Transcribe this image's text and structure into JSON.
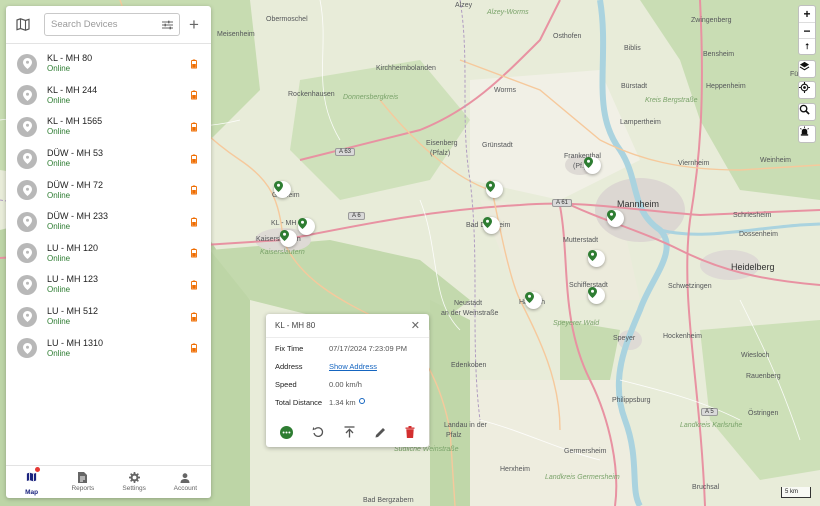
{
  "search": {
    "placeholder": "Search Devices"
  },
  "devices": [
    {
      "name": "KL - MH 80",
      "status": "Online"
    },
    {
      "name": "KL - MH 244",
      "status": "Online"
    },
    {
      "name": "KL - MH 1565",
      "status": "Online"
    },
    {
      "name": "DÜW - MH 53",
      "status": "Online"
    },
    {
      "name": "DÜW - MH 72",
      "status": "Online"
    },
    {
      "name": "DÜW - MH 233",
      "status": "Online"
    },
    {
      "name": "LU - MH 120",
      "status": "Online"
    },
    {
      "name": "LU - MH 123",
      "status": "Online"
    },
    {
      "name": "LU - MH 512",
      "status": "Online"
    },
    {
      "name": "LU - MH 1310",
      "status": "Online"
    }
  ],
  "nav": {
    "map": "Map",
    "reports": "Reports",
    "settings": "Settings",
    "account": "Account"
  },
  "popup": {
    "title": "KL - MH 80",
    "fix_time_label": "Fix Time",
    "fix_time": "07/17/2024 7:23:09 PM",
    "address_label": "Address",
    "address_link": "Show Address",
    "speed_label": "Speed",
    "speed": "0.00 km/h",
    "distance_label": "Total Distance",
    "distance": "1.34 km"
  },
  "map": {
    "places": {
      "obermoschel": "Obermoschel",
      "meisenheim": "Meisenheim",
      "alzey": "Alzey",
      "alzey_worms": "Alzey-Worms",
      "osthofen": "Osthofen",
      "zwingenberg": "Zwingenberg",
      "bensheim": "Bensheim",
      "biblis": "Biblis",
      "kirchheimbolanden": "Kirchheimbolanden",
      "donnersberg": "Donnersbergkreis",
      "rockenhausen": "Rockenhausen",
      "worms": "Worms",
      "buerstadt": "Bürstadt",
      "heppenheim": "Heppenheim",
      "kreis_bergstrasse": "Kreis Bergstraße",
      "lampertheim": "Lampertheim",
      "fuerth": "Fürth",
      "eisenberg": "Eisenberg",
      "pfalz": "(Pfalz)",
      "gruenstadt": "Grünstadt",
      "frankenthal": "Frankenthal",
      "frankenthal_pf": "(Pf.)",
      "viernheim": "Viernheim",
      "weinheim": "Weinheim",
      "mannheim": "Mannheim",
      "schriesheim": "Schriesheim",
      "dossenheim": "Dossenheim",
      "heidelberg": "Heidelberg",
      "goellheim": "Göllheim",
      "kaiserslautern": "Kaiserslautern",
      "kaiserslautern_lk": "Kaiserslautern",
      "kl_mh": "KL - MH",
      "bad_duerkheim": "Bad Dürkheim",
      "mutterstadt": "Mutterstadt",
      "schifferstadt": "Schifferstadt",
      "schwetzingen": "Schwetzingen",
      "neustadt": "Neustadt",
      "an_der_weinstr": "an der Weinstraße",
      "hassloch": "Haßloch",
      "speyerer_wald": "Speyerer Wald",
      "speyer": "Speyer",
      "hockenheim": "Hockenheim",
      "wiesloch": "Wiesloch",
      "edenkoben": "Edenkoben",
      "rauenberg": "Rauenberg",
      "philippsburg": "Philippsburg",
      "oestringen": "Östringen",
      "landau": "Landau in der",
      "landau2": "Pfalz",
      "suedl_weinstr": "Südliche Weinstraße",
      "germersheim": "Germersheim",
      "karlsruhe": "Landkreis Karlsruhe",
      "herxheim": "Herxheim",
      "bruchsal": "Bruchsal",
      "bad_bergzabern": "Bad Bergzabern",
      "landkreis_germersheim": "Landkreis Germersheim"
    },
    "highways": {
      "a63": "A 63",
      "a6": "A 6",
      "a61": "A 61",
      "a5": "A 5"
    },
    "scale": "5 km"
  }
}
